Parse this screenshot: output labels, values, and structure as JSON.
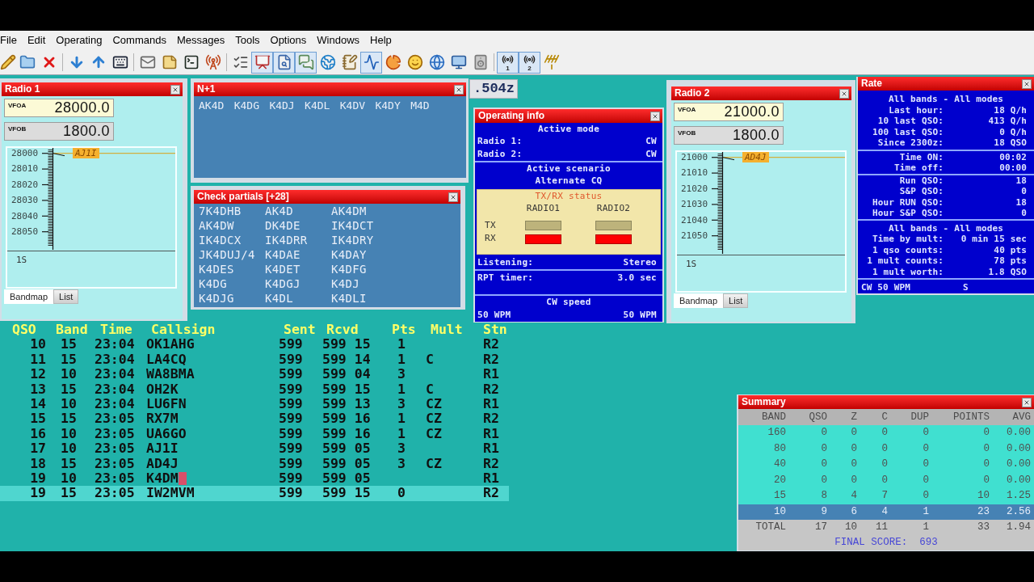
{
  "menu": [
    "File",
    "Edit",
    "Operating",
    "Commands",
    "Messages",
    "Tools",
    "Options",
    "Windows",
    "Help"
  ],
  "toolbar": [
    {
      "items": [
        {
          "kind": "wand",
          "pressed": false
        },
        {
          "kind": "folder",
          "pressed": false
        },
        {
          "kind": "delete",
          "pressed": false
        }
      ]
    },
    {
      "items": [
        {
          "kind": "down",
          "pressed": false
        },
        {
          "kind": "up",
          "pressed": false
        },
        {
          "kind": "keyboard",
          "pressed": false
        }
      ]
    },
    {
      "items": [
        {
          "kind": "mail",
          "pressed": false
        },
        {
          "kind": "note",
          "pressed": false
        },
        {
          "kind": "terminal",
          "pressed": false
        },
        {
          "kind": "tower",
          "pressed": false
        }
      ]
    },
    {
      "items": [
        {
          "kind": "checklist",
          "pressed": false
        },
        {
          "kind": "presentation",
          "pressed": true
        },
        {
          "kind": "search",
          "pressed": true
        },
        {
          "kind": "chat",
          "pressed": true
        },
        {
          "kind": "network",
          "pressed": false
        },
        {
          "kind": "notebook",
          "pressed": false
        },
        {
          "kind": "scope",
          "pressed": true
        },
        {
          "kind": "pie",
          "pressed": false
        },
        {
          "kind": "smiley",
          "pressed": false
        },
        {
          "kind": "globe",
          "pressed": false
        },
        {
          "kind": "monitor",
          "pressed": false
        },
        {
          "kind": "speaker",
          "pressed": false
        }
      ]
    },
    {
      "items": [
        {
          "kind": "radio",
          "label": "1",
          "pressed": true
        },
        {
          "kind": "radio",
          "label": "2",
          "pressed": true
        },
        {
          "kind": "antenna",
          "pressed": false
        }
      ]
    }
  ],
  "radio_1": {
    "title": "Radio 1",
    "vfos": [
      {
        "label": "VFOA",
        "value": "28000.0",
        "active": true
      },
      {
        "label": "VFOB",
        "value": "1800.0",
        "active": false
      }
    ],
    "bandmap": {
      "scale": [
        "28000",
        "28010",
        "28020",
        "28030",
        "28040",
        "28050"
      ],
      "spot": "AJ1I",
      "status": "1S"
    },
    "tabs": [
      {
        "label": "Bandmap",
        "selected": true
      },
      {
        "label": "List",
        "selected": false
      }
    ]
  },
  "n_plus_1": {
    "title": "N+1",
    "calls": [
      "AK4D",
      "K4DG",
      "K4DJ",
      "K4DL",
      "K4DV",
      "K4DY",
      "M4D"
    ]
  },
  "check_partials": {
    "title": "Check partials [+28]",
    "calls": [
      "7K4DHB",
      "AK4D",
      "AK4DM",
      "AK4DW",
      "DK4DE",
      "IK4DCT",
      "IK4DCX",
      "IK4DRR",
      "IK4DRY",
      "JK4DUJ/4",
      "K4DAE",
      "K4DAY",
      "K4DES",
      "K4DET",
      "K4DFG",
      "K4DG",
      "K4DGJ",
      "K4DJ",
      "K4DJG",
      "K4DL",
      "K4DLI"
    ]
  },
  "time_display": ".504z",
  "operating_info": {
    "title": "Operating info",
    "active_mode": {
      "heading": "Active mode",
      "rows": [
        {
          "label": "Radio 1:",
          "value": "CW"
        },
        {
          "label": "Radio 2:",
          "value": "CW"
        }
      ]
    },
    "scenario": {
      "heading": "Active scenario",
      "value": "Alternate CQ"
    },
    "txrx": {
      "heading": "TX/RX status",
      "tx_label": "TX",
      "rx_label": "RX",
      "radios": [
        {
          "name": "RADIO1",
          "tx": false,
          "rx": true
        },
        {
          "name": "RADIO2",
          "tx": false,
          "rx": true
        }
      ]
    },
    "listening": {
      "label": "Listening:",
      "value": "Stereo"
    },
    "rpt_timer": {
      "label": "RPT timer:",
      "value": "3.0 sec"
    },
    "cw_speed": {
      "heading": "CW speed",
      "values": [
        "50 WPM",
        "50 WPM"
      ]
    }
  },
  "radio_2": {
    "title": "Radio 2",
    "vfos": [
      {
        "label": "VFOA",
        "value": "21000.0",
        "active": true
      },
      {
        "label": "VFOB",
        "value": "1800.0",
        "active": false
      }
    ],
    "bandmap": {
      "scale": [
        "21000",
        "21010",
        "21020",
        "21030",
        "21040",
        "21050"
      ],
      "spot": "AD4J",
      "status": "1S"
    },
    "tabs": [
      {
        "label": "Bandmap",
        "selected": true
      },
      {
        "label": "List",
        "selected": false
      }
    ]
  },
  "rate": {
    "title": "Rate",
    "sections": [
      {
        "heading": "All bands - All modes",
        "rows": [
          {
            "label": "Last hour:",
            "value": "18 Q/h"
          },
          {
            "label": "10 last QSO:",
            "value": "413 Q/h"
          },
          {
            "label": "100 last QSO:",
            "value": "0 Q/h"
          },
          {
            "label": "Since 2300z:",
            "value": "18 QSO"
          }
        ]
      },
      {
        "rows": [
          {
            "label": "Time ON:",
            "value": "00:02"
          },
          {
            "label": "Time off:",
            "value": "00:00"
          }
        ]
      },
      {
        "rows": [
          {
            "label": "Run QSO:",
            "value": "18"
          },
          {
            "label": "S&P QSO:",
            "value": "0"
          },
          {
            "label": "Hour RUN QSO:",
            "value": "18"
          },
          {
            "label": "Hour S&P QSO:",
            "value": "0"
          }
        ]
      },
      {
        "heading": "All bands - All modes",
        "rows": [
          {
            "label": "Time by mult:",
            "value": "0 min 15 sec"
          },
          {
            "label": "1 qso counts:",
            "value": "40 pts"
          },
          {
            "label": "1 mult counts:",
            "value": "78 pts"
          },
          {
            "label": "1 mult worth:",
            "value": "1.8 QSO"
          }
        ]
      }
    ],
    "footer": {
      "speed": "CW 50 WPM",
      "status": "S"
    }
  },
  "log": {
    "columns": [
      "QSO",
      "Band",
      "Time",
      "Callsign",
      "Sent",
      "Rcvd",
      "Pts",
      "Mult",
      "Stn"
    ],
    "rows": [
      {
        "qso": "10",
        "band": "15",
        "time": "23:04",
        "call": "OK1AHG",
        "sent": "599",
        "rcvd": "599 15",
        "pts": "1",
        "stn": "R2",
        "selected": false,
        "cursor": false
      },
      {
        "qso": "11",
        "band": "15",
        "time": "23:04",
        "call": "LA4CQ",
        "sent": "599",
        "rcvd": "599 14",
        "pts": "1",
        "mult": "C",
        "stn": "R2",
        "selected": false,
        "cursor": false
      },
      {
        "qso": "12",
        "band": "10",
        "time": "23:04",
        "call": "WA8BMA",
        "sent": "599",
        "rcvd": "599 04",
        "pts": "3",
        "stn": "R1",
        "selected": false,
        "cursor": false
      },
      {
        "qso": "13",
        "band": "15",
        "time": "23:04",
        "call": "OH2K",
        "sent": "599",
        "rcvd": "599 15",
        "pts": "1",
        "mult": "C",
        "stn": "R2",
        "selected": false,
        "cursor": false
      },
      {
        "qso": "14",
        "band": "10",
        "time": "23:04",
        "call": "LU6FN",
        "sent": "599",
        "rcvd": "599 13",
        "pts": "3",
        "mult": "CZ",
        "stn": "R1",
        "selected": false,
        "cursor": false
      },
      {
        "qso": "15",
        "band": "15",
        "time": "23:05",
        "call": "RX7M",
        "sent": "599",
        "rcvd": "599 16",
        "pts": "1",
        "mult": "CZ",
        "stn": "R2",
        "selected": false,
        "cursor": false
      },
      {
        "qso": "16",
        "band": "10",
        "time": "23:05",
        "call": "UA6GO",
        "sent": "599",
        "rcvd": "599 16",
        "pts": "1",
        "mult": "CZ",
        "stn": "R1",
        "selected": false,
        "cursor": false
      },
      {
        "qso": "17",
        "band": "10",
        "time": "23:05",
        "call": "AJ1I",
        "sent": "599",
        "rcvd": "599 05",
        "pts": "3",
        "stn": "R1",
        "selected": false,
        "cursor": false
      },
      {
        "qso": "18",
        "band": "15",
        "time": "23:05",
        "call": "AD4J",
        "sent": "599",
        "rcvd": "599 05",
        "pts": "3",
        "mult": "CZ",
        "stn": "R2",
        "selected": false,
        "cursor": false
      },
      {
        "qso": "19",
        "band": "10",
        "time": "23:05",
        "call": "K4DM",
        "sent": "599",
        "rcvd": "599 05",
        "stn": "R1",
        "selected": false,
        "cursor": true
      },
      {
        "qso": "19",
        "band": "15",
        "time": "23:05",
        "call": "IW2MVM",
        "sent": "599",
        "rcvd": "599 15",
        "pts": "0",
        "stn": "R2",
        "selected": true,
        "cursor": false
      }
    ]
  },
  "summary": {
    "title": "Summary",
    "columns": [
      "BAND",
      "QSO",
      "Z",
      "C",
      "DUP",
      "POINTS",
      "AVG"
    ],
    "rows": [
      {
        "cells": [
          "160",
          "0",
          "0",
          "0",
          "0",
          "0",
          "0.00"
        ],
        "selected": false
      },
      {
        "cells": [
          "80",
          "0",
          "0",
          "0",
          "0",
          "0",
          "0.00"
        ],
        "selected": false
      },
      {
        "cells": [
          "40",
          "0",
          "0",
          "0",
          "0",
          "0",
          "0.00"
        ],
        "selected": false
      },
      {
        "cells": [
          "20",
          "0",
          "0",
          "0",
          "0",
          "0",
          "0.00"
        ],
        "selected": false
      },
      {
        "cells": [
          "15",
          "8",
          "4",
          "7",
          "0",
          "10",
          "1.25"
        ],
        "selected": false
      },
      {
        "cells": [
          "10",
          "9",
          "6",
          "4",
          "1",
          "23",
          "2.56"
        ],
        "selected": true
      }
    ],
    "total": [
      "TOTAL",
      "17",
      "10",
      "11",
      "1",
      "33",
      "1.94"
    ],
    "final_score": {
      "label": "FINAL SCORE:",
      "value": "693"
    }
  }
}
